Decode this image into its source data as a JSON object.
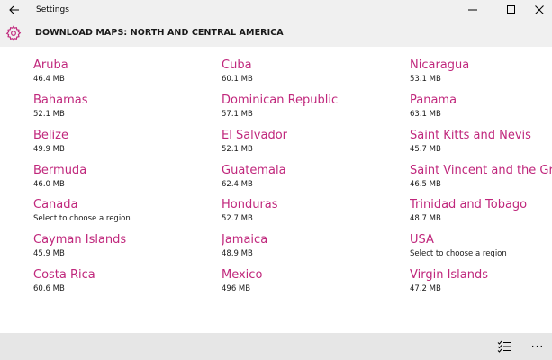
{
  "window": {
    "title": "Settings"
  },
  "header": {
    "title": "DOWNLOAD MAPS: NORTH AND CENTRAL AMERICA"
  },
  "accent_color": "#c0277c",
  "columns": [
    {
      "items": [
        {
          "name": "Aruba",
          "size": "46.4 MB"
        },
        {
          "name": "Bahamas",
          "size": "52.1 MB"
        },
        {
          "name": "Belize",
          "size": "49.9 MB"
        },
        {
          "name": "Bermuda",
          "size": "46.0 MB"
        },
        {
          "name": "Canada",
          "size": "Select to choose a region"
        },
        {
          "name": "Cayman Islands",
          "size": "45.9 MB"
        },
        {
          "name": "Costa Rica",
          "size": "60.6 MB"
        }
      ]
    },
    {
      "items": [
        {
          "name": "Cuba",
          "size": "60.1 MB"
        },
        {
          "name": "Dominican Republic",
          "size": "57.1 MB"
        },
        {
          "name": "El Salvador",
          "size": "52.1 MB"
        },
        {
          "name": "Guatemala",
          "size": "62.4 MB"
        },
        {
          "name": "Honduras",
          "size": "52.7 MB"
        },
        {
          "name": "Jamaica",
          "size": "48.9 MB"
        },
        {
          "name": "Mexico",
          "size": "496 MB"
        }
      ]
    },
    {
      "items": [
        {
          "name": "Nicaragua",
          "size": "53.1 MB"
        },
        {
          "name": "Panama",
          "size": "63.1 MB"
        },
        {
          "name": "Saint Kitts and Nevis",
          "size": "45.7 MB"
        },
        {
          "name": "Saint Vincent and the Gr…",
          "size": "46.5 MB"
        },
        {
          "name": "Trinidad and Tobago",
          "size": "48.7 MB"
        },
        {
          "name": "USA",
          "size": "Select to choose a region"
        },
        {
          "name": "Virgin Islands",
          "size": "47.2 MB"
        }
      ]
    }
  ],
  "footer": {
    "icons": [
      "select-list-icon",
      "more-icon"
    ],
    "more_glyph": "···"
  }
}
